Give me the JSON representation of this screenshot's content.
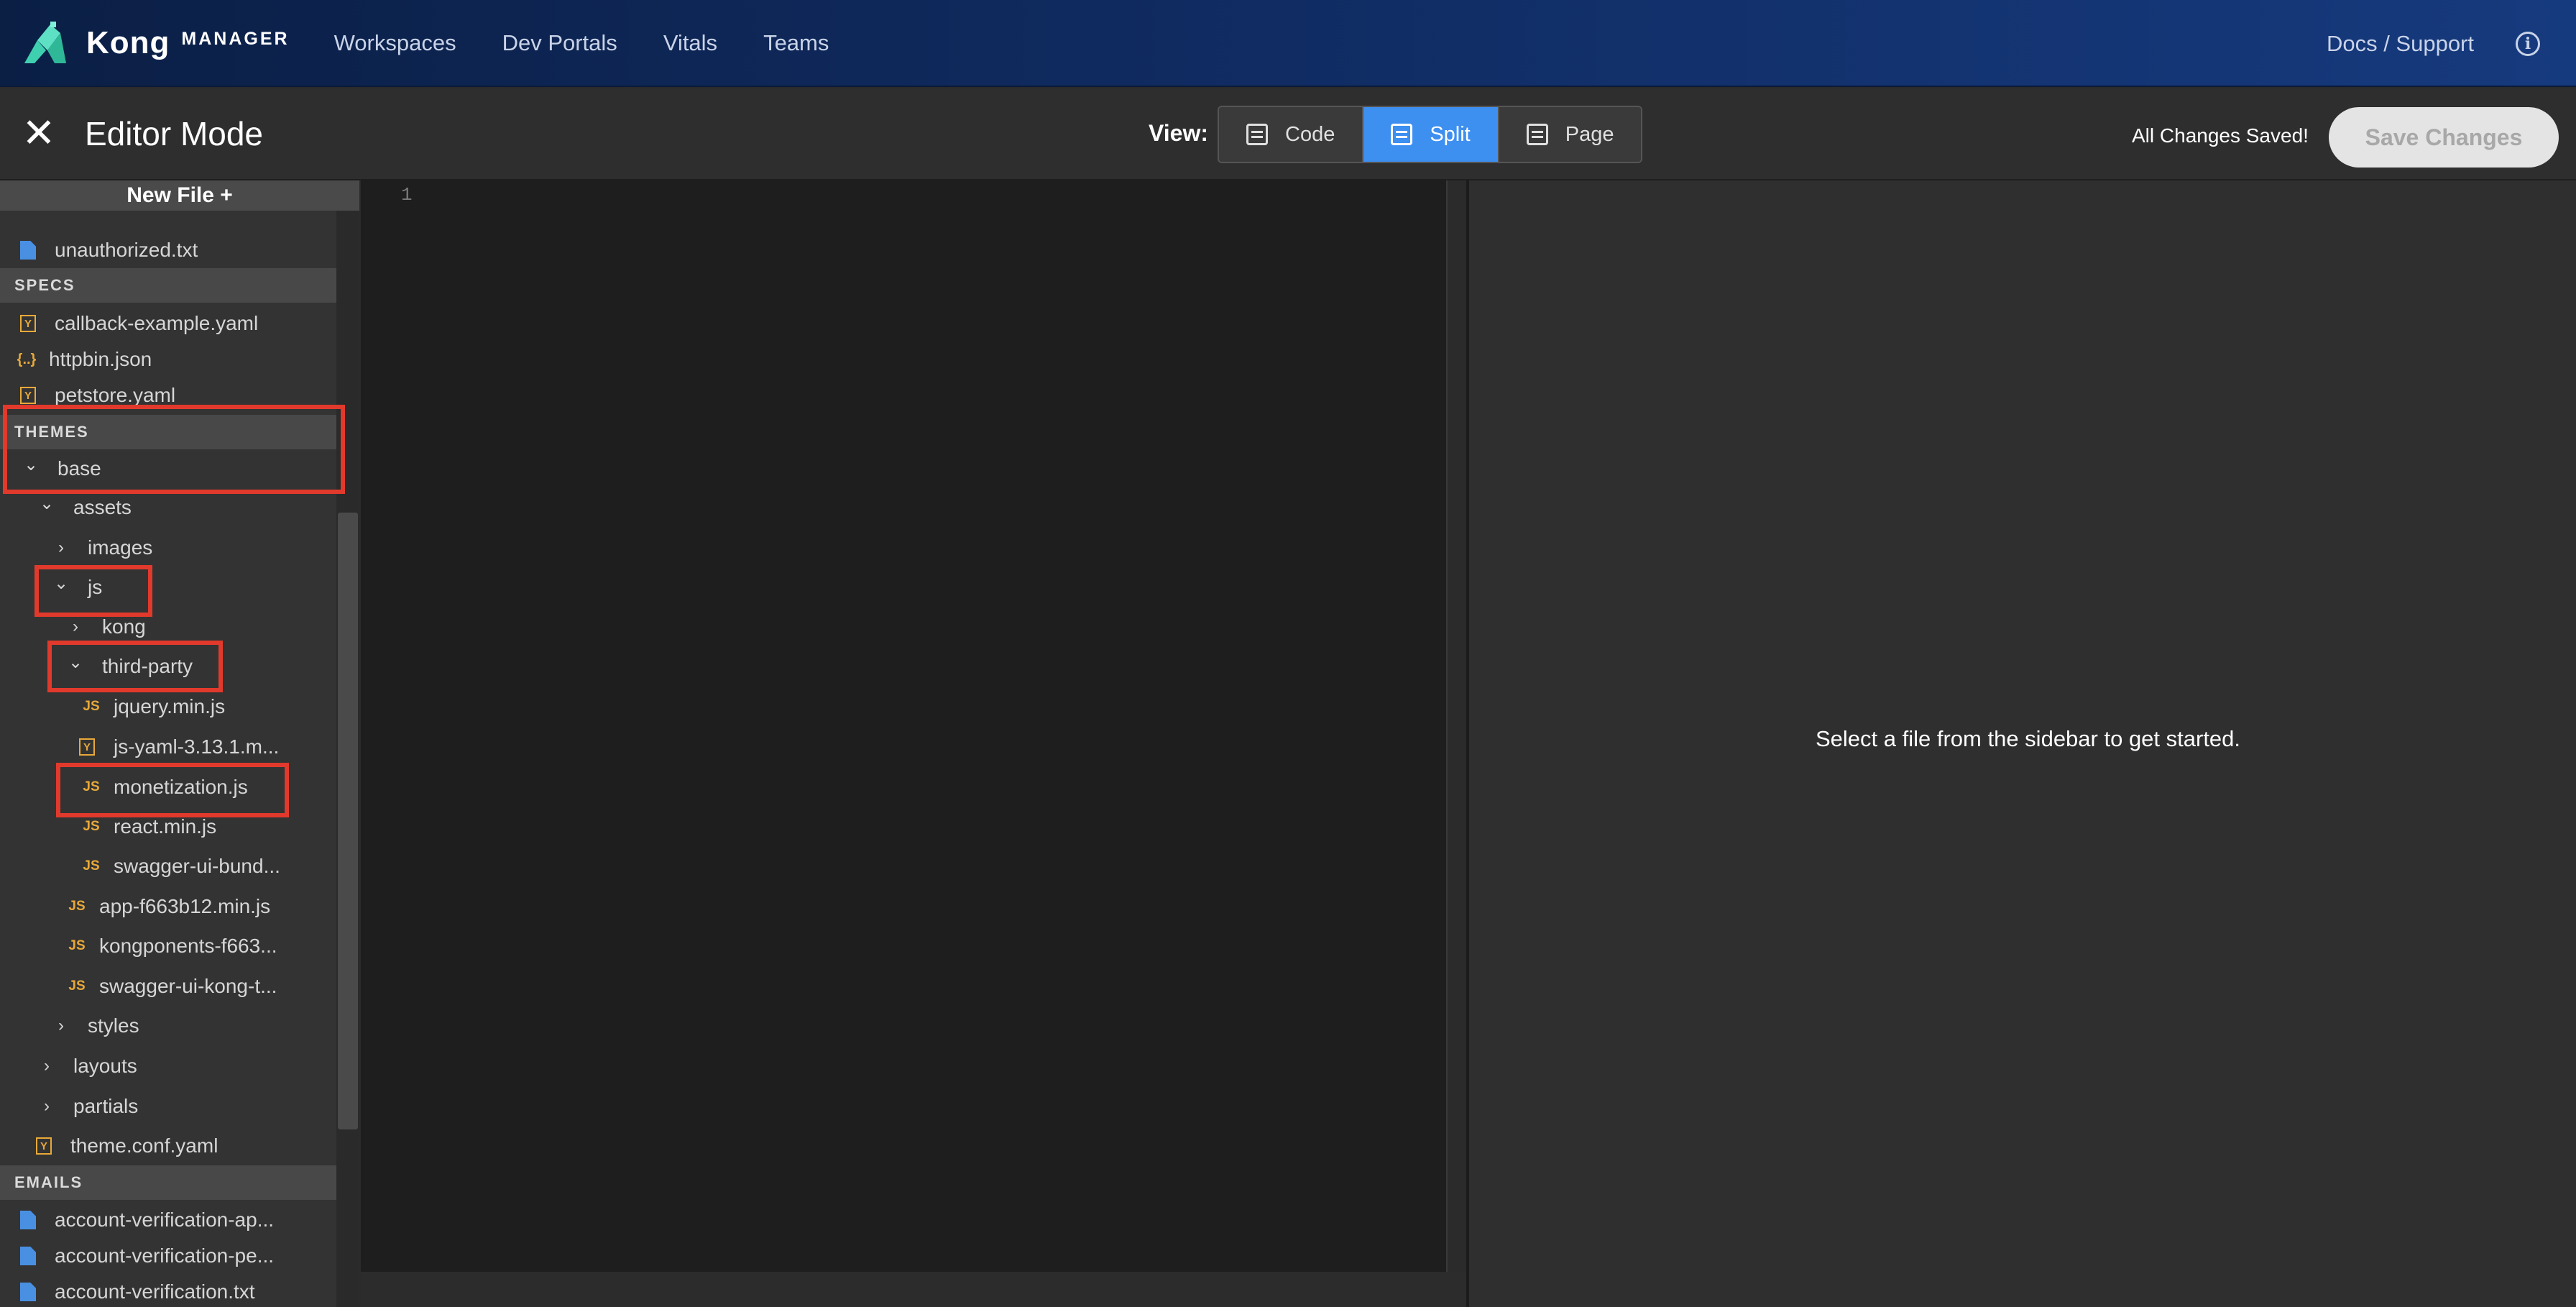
{
  "nav": {
    "brand": "Kong",
    "brand_sub": "MANAGER",
    "links": [
      "Workspaces",
      "Dev Portals",
      "Vitals",
      "Teams"
    ],
    "docs": "Docs / Support"
  },
  "editor_bar": {
    "title": "Editor Mode",
    "view_label": "View:",
    "views": [
      {
        "label": "Code",
        "active": false
      },
      {
        "label": "Split",
        "active": true
      },
      {
        "label": "Page",
        "active": false
      }
    ],
    "status": "All Changes Saved!",
    "save_label": "Save Changes"
  },
  "sidebar": {
    "new_file": "New File +",
    "items": [
      {
        "type": "file",
        "icon": "doc",
        "label": "unauthorized.txt"
      },
      {
        "type": "section",
        "label": "SPECS"
      },
      {
        "type": "file",
        "icon": "yaml",
        "label": "callback-example.yaml"
      },
      {
        "type": "file",
        "icon": "json",
        "label": "httpbin.json"
      },
      {
        "type": "file",
        "icon": "yaml",
        "label": "petstore.yaml"
      },
      {
        "type": "section",
        "label": "THEMES"
      },
      {
        "type": "folder",
        "expanded": true,
        "label": "base"
      },
      {
        "type": "folder",
        "expanded": true,
        "label": "assets"
      },
      {
        "type": "folder",
        "expanded": false,
        "label": "images"
      },
      {
        "type": "folder",
        "expanded": true,
        "label": "js"
      },
      {
        "type": "folder",
        "expanded": false,
        "label": "kong"
      },
      {
        "type": "folder",
        "expanded": true,
        "label": "third-party"
      },
      {
        "type": "file",
        "icon": "js",
        "label": "jquery.min.js"
      },
      {
        "type": "file",
        "icon": "yaml",
        "label": "js-yaml-3.13.1.m..."
      },
      {
        "type": "file",
        "icon": "js",
        "label": "monetization.js"
      },
      {
        "type": "file",
        "icon": "js",
        "label": "react.min.js"
      },
      {
        "type": "file",
        "icon": "js",
        "label": "swagger-ui-bund..."
      },
      {
        "type": "file",
        "icon": "js",
        "label": "app-f663b12.min.js"
      },
      {
        "type": "file",
        "icon": "js",
        "label": "kongponents-f663..."
      },
      {
        "type": "file",
        "icon": "js",
        "label": "swagger-ui-kong-t..."
      },
      {
        "type": "folder",
        "expanded": false,
        "label": "styles"
      },
      {
        "type": "folder",
        "expanded": false,
        "label": "layouts"
      },
      {
        "type": "folder",
        "expanded": false,
        "label": "partials"
      },
      {
        "type": "file",
        "icon": "yaml",
        "label": "theme.conf.yaml"
      },
      {
        "type": "section",
        "label": "EMAILS"
      },
      {
        "type": "file",
        "icon": "doc",
        "label": "account-verification-ap..."
      },
      {
        "type": "file",
        "icon": "doc",
        "label": "account-verification-pe..."
      },
      {
        "type": "file",
        "icon": "doc",
        "label": "account-verification.txt"
      }
    ]
  },
  "code_editor": {
    "line_number": "1"
  },
  "preview": {
    "message": "Select a file from the sidebar to get started."
  },
  "icons": {
    "yaml": "Y",
    "json": "{..}",
    "js": "JS",
    "close": "✕",
    "info": "i",
    "chevron_down": "⌄",
    "chevron_right": "›"
  },
  "colors": {
    "accent": "#3d8ff0",
    "highlight": "#e13a2c",
    "file_icon_blue": "#4a90e2",
    "file_icon_orange": "#e8a93a"
  }
}
